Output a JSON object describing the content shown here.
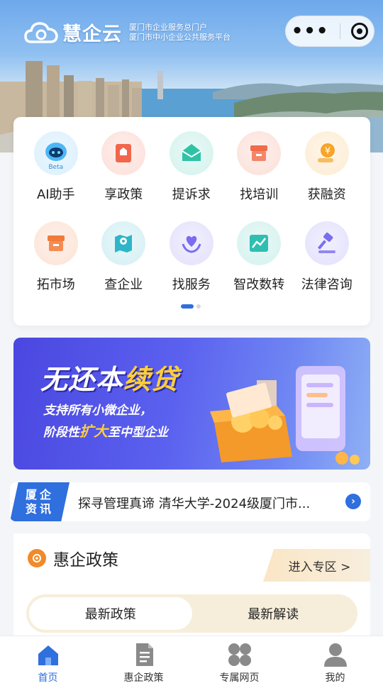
{
  "header": {
    "brand": "慧企云",
    "subtitle_line1": "厦门市企业服务总门户",
    "subtitle_line2": "厦门市中小企业公共服务平台",
    "capsule_more": "•••"
  },
  "services": [
    {
      "label": "AI助手",
      "icon": "ai-robot-icon",
      "badge": "Beta",
      "color": "#4fb6f5"
    },
    {
      "label": "享政策",
      "icon": "policy-book-icon",
      "color": "#f2674b"
    },
    {
      "label": "提诉求",
      "icon": "envelope-icon",
      "color": "#2fc3a6"
    },
    {
      "label": "找培训",
      "icon": "training-box-icon",
      "color": "#f06b4a"
    },
    {
      "label": "获融资",
      "icon": "finance-coin-icon",
      "color": "#f5a52a"
    },
    {
      "label": "拓市场",
      "icon": "market-box-icon",
      "color": "#f27a3a"
    },
    {
      "label": "查企业",
      "icon": "map-pin-icon",
      "color": "#2fb5c9"
    },
    {
      "label": "找服务",
      "icon": "heart-hands-icon",
      "color": "#7b6cf0"
    },
    {
      "label": "智改数转",
      "icon": "trend-chart-icon",
      "color": "#2fbfb0"
    },
    {
      "label": "法律咨询",
      "icon": "gavel-icon",
      "color": "#7a6ef0"
    }
  ],
  "banner": {
    "title_a": "无还本",
    "title_b": "续贷",
    "line1": "支持所有小微企业，",
    "line2_a": "阶段性",
    "line2_b": "扩大",
    "line2_c": "至中型企业"
  },
  "news": {
    "tag_line1": "厦企",
    "tag_line2": "资讯",
    "headline": "探寻管理真谛 清华大学-2024级厦门市..."
  },
  "policy": {
    "title": "惠企政策",
    "enter": "进入专区 >",
    "tabs": [
      "最新政策",
      "最新解读"
    ]
  },
  "tabbar": [
    {
      "label": "首页",
      "icon": "home-icon",
      "active": true
    },
    {
      "label": "惠企政策",
      "icon": "document-icon"
    },
    {
      "label": "专属网页",
      "icon": "clover-grid-icon"
    },
    {
      "label": "我的",
      "icon": "user-icon"
    }
  ],
  "colors": {
    "accent": "#2f6fde",
    "banner_bg": "#5158e8",
    "highlight": "#ffcf3a"
  }
}
